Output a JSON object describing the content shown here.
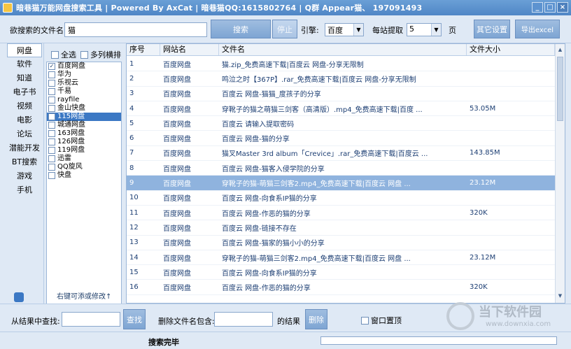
{
  "window": {
    "title": "暗巷猫万能网盘搜索工具 | Powered By AxCat | 暗巷猫QQ:1615802764 | Q群 Appear猫、 197091493",
    "buttons": [
      "_",
      "□",
      "×"
    ]
  },
  "search": {
    "filename_label": "欲搜索的文件名:",
    "query": "猫",
    "search_button": "搜索",
    "stop_button": "停止",
    "engine_label": "引擎:",
    "engine_value": "百度",
    "per_site_label": "每站提取",
    "per_site_value": "5",
    "page_unit": "页",
    "settings_button": "其它设置",
    "export_button": "导出excel"
  },
  "categories": [
    "网盘",
    "软件",
    "知道",
    "电子书",
    "视频",
    "电影",
    "论坛",
    "潜能开发",
    "BT搜索",
    "游戏",
    "手机"
  ],
  "sites_panel": {
    "select_all": "全选",
    "multi_column": "多列横排",
    "footer": "右键可添或修改↑",
    "sites": [
      {
        "name": "百度网盘",
        "checked": true,
        "selected": false
      },
      {
        "name": "华为",
        "checked": false,
        "selected": false
      },
      {
        "name": "乐视云",
        "checked": false,
        "selected": false
      },
      {
        "name": "千易",
        "checked": false,
        "selected": false
      },
      {
        "name": "rayfile",
        "checked": false,
        "selected": false
      },
      {
        "name": "金山快盘",
        "checked": false,
        "selected": false
      },
      {
        "name": "115网盘",
        "checked": false,
        "selected": true
      },
      {
        "name": "城通网盘",
        "checked": false,
        "selected": false
      },
      {
        "name": "163网盘",
        "checked": false,
        "selected": false
      },
      {
        "name": "126网盘",
        "checked": false,
        "selected": false
      },
      {
        "name": "119网盘",
        "checked": false,
        "selected": false
      },
      {
        "name": "迅雷",
        "checked": false,
        "selected": false
      },
      {
        "name": "QQ旋风",
        "checked": false,
        "selected": false
      },
      {
        "name": "快盘",
        "checked": false,
        "selected": false
      }
    ]
  },
  "results": {
    "columns": [
      "序号",
      "网站名",
      "文件名",
      "文件大小"
    ],
    "selected_row": 9,
    "rows": [
      {
        "no": "1",
        "site": "百度网盘",
        "file": "猫.zip_免费高速下载|百度云 网盘-分享无限制",
        "size": ""
      },
      {
        "no": "2",
        "site": "百度网盘",
        "file": "鸣泣之时【367P】.rar_免费高速下载|百度云 网盘-分享无限制",
        "size": ""
      },
      {
        "no": "3",
        "site": "百度网盘",
        "file": "百度云 网盘-猫猫_度孩子的分享",
        "size": ""
      },
      {
        "no": "4",
        "site": "百度网盘",
        "file": "穿靴子的猫之萌猫三剑客（高清版）.mp4_免费高速下载|百度 ...",
        "size": "53.05M"
      },
      {
        "no": "5",
        "site": "百度网盘",
        "file": "百度云 请输入提取密码",
        "size": ""
      },
      {
        "no": "6",
        "site": "百度网盘",
        "file": "百度云 网盘-猫的分享",
        "size": ""
      },
      {
        "no": "7",
        "site": "百度网盘",
        "file": "猫叉Master 3rd album「Crevice」.rar_免费高速下载|百度云 ...",
        "size": "143.85M"
      },
      {
        "no": "8",
        "site": "百度网盘",
        "file": "百度云 网盘-猫客入侵学院的分享",
        "size": ""
      },
      {
        "no": "9",
        "site": "百度网盘",
        "file": "穿靴子的猫-萌猫三剑客2.mp4_免费高速下载|百度云 网盘 ...",
        "size": "23.12M"
      },
      {
        "no": "10",
        "site": "百度网盘",
        "file": "百度云 网盘-向食系IP猫的分享",
        "size": ""
      },
      {
        "no": "11",
        "site": "百度网盘",
        "file": "百度云 网盘-作恶的猫的分享",
        "size": "320K"
      },
      {
        "no": "12",
        "site": "百度网盘",
        "file": "百度云 网盘-链接不存在",
        "size": ""
      },
      {
        "no": "13",
        "site": "百度网盘",
        "file": "百度云 网盘-猫家的猫小小的分享",
        "size": ""
      },
      {
        "no": "14",
        "site": "百度网盘",
        "file": "穿靴子的猫-萌猫三剑客2.mp4_免费高速下载|百度云 网盘 ...",
        "size": "23.12M"
      },
      {
        "no": "15",
        "site": "百度网盘",
        "file": "百度云 网盘-向食系IP猫的分享",
        "size": ""
      },
      {
        "no": "16",
        "site": "百度网盘",
        "file": "百度云 网盘-作恶的猫的分享",
        "size": "320K"
      }
    ]
  },
  "bottom": {
    "find_label": "从结果中查找:",
    "find_value": "",
    "find_button": "查找",
    "delete_label": "删除文件名包含:",
    "delete_value": "",
    "results_suffix": "的结果",
    "delete_button": "删除",
    "ontop_label": "窗口置顶"
  },
  "status": {
    "text": "搜索完毕",
    "progress": 0
  },
  "watermark": {
    "name": "当下软件园",
    "url": "www.downxia.com"
  }
}
